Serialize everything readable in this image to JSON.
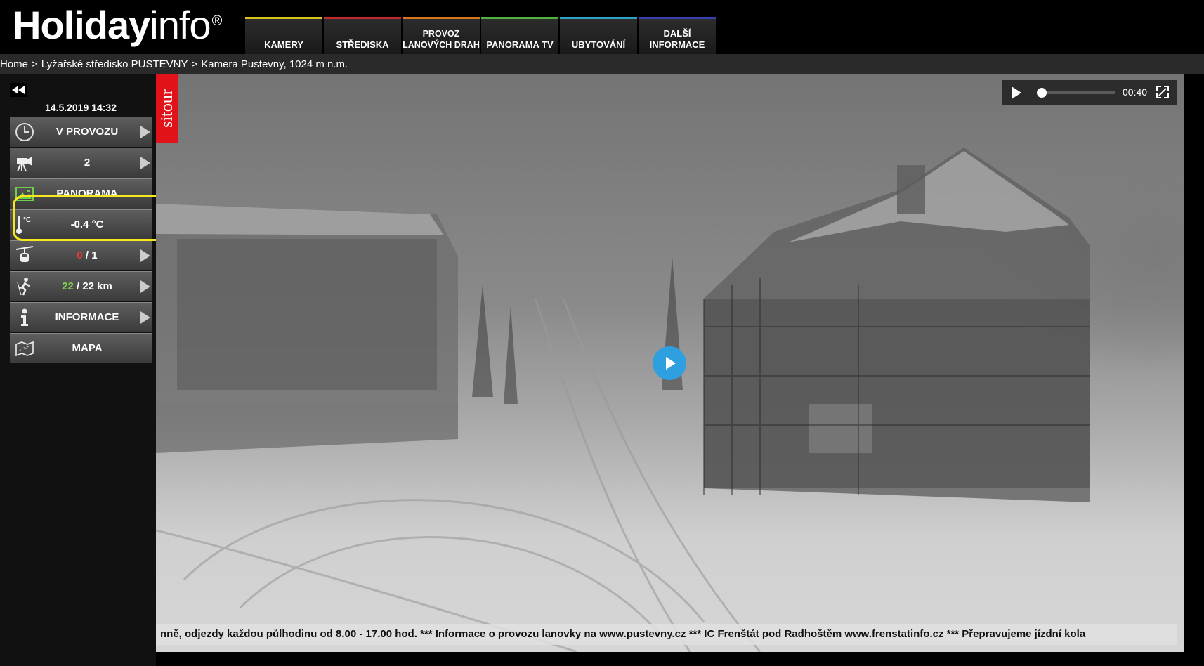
{
  "logo": {
    "bold": "Holiday",
    "light": "info",
    "mark": "®"
  },
  "nav": [
    {
      "label": "KAMERY",
      "color": "#d8c31a"
    },
    {
      "label": "STŘEDISKA",
      "color": "#c0282d"
    },
    {
      "label": "PROVOZ LANOVÝCH DRAH",
      "color": "#d8741a"
    },
    {
      "label": "PANORAMA TV",
      "color": "#4db33d"
    },
    {
      "label": "UBYTOVÁNÍ",
      "color": "#2aa3c7"
    },
    {
      "label": "DALŠÍ INFORMACE",
      "color": "#3a3fb0"
    }
  ],
  "breadcrumb": [
    {
      "label": "Home"
    },
    {
      "label": "Lyžařské středisko PUSTEVNY"
    },
    {
      "label": "Kamera Pustevny, 1024 m n.m."
    }
  ],
  "side": {
    "datetime": "14.5.2019 14:32",
    "status": "V PROVOZU",
    "cameras": "2",
    "panorama": "PANORAMA",
    "temperature": "-0.4 °C",
    "lifts_open": "0",
    "lifts_sep": " / ",
    "lifts_total": "1",
    "tracks_open": "22",
    "tracks_sep": " / ",
    "tracks_total": "22 km",
    "info": "INFORMACE",
    "map": "MAPA",
    "temp_icon_label": "°C"
  },
  "video": {
    "brand": "sitour",
    "time": "00:40",
    "progress": 0,
    "ticker": "nně, odjezdy každou půlhodinu od 8.00 - 17.00 hod. *** Informace o provozu lanovky na www.pustevny.cz *** IC Frenštát pod Radhoštěm www.frenstatinfo.cz *** Přepravujeme jízdní kola"
  }
}
